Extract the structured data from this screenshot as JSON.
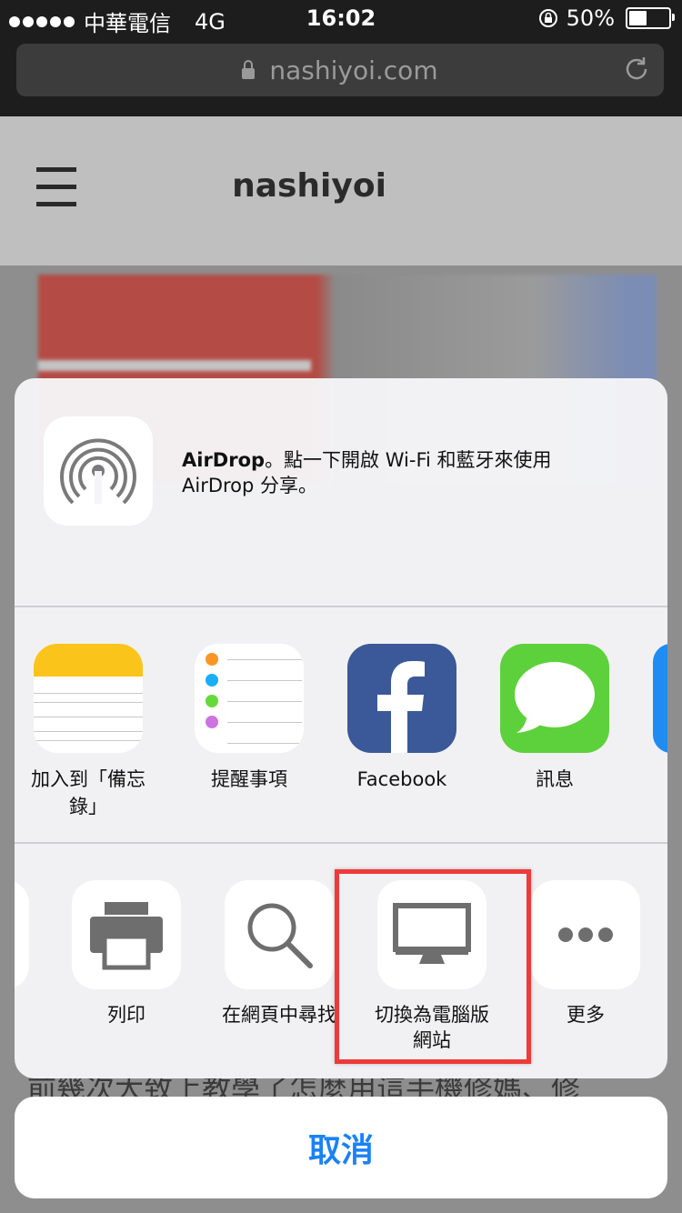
{
  "status_bar": {
    "carrier": "中華電信",
    "network": "4G",
    "time": "16:02",
    "battery": "50%",
    "battery_level": 0.5
  },
  "browser": {
    "url": "nashiyoi.com",
    "lock_icon": "lock-icon",
    "reload_icon": "reload-icon"
  },
  "site": {
    "title": "nashiyoi",
    "menu_icon": "hamburger-icon",
    "article_text": "前幾次大致上教學了怎麼用這手機修媽、修"
  },
  "share_sheet": {
    "airdrop": {
      "title": "AirDrop",
      "description_line1": "。點一下開啟 Wi-Fi 和藍牙來使用",
      "description_line2": "AirDrop 分享。",
      "icon": "airdrop-icon"
    },
    "apps": [
      {
        "label_line1": "加入到「備忘",
        "label_line2": "錄」",
        "icon": "notes-icon"
      },
      {
        "label_line1": "提醒事項",
        "label_line2": "",
        "icon": "reminders-icon"
      },
      {
        "label_line1": "Facebook",
        "label_line2": "",
        "icon": "facebook-icon"
      },
      {
        "label_line1": "訊息",
        "label_line2": "",
        "icon": "messages-icon"
      }
    ],
    "actions": [
      {
        "label_line1": "列印",
        "label_line2": "",
        "icon": "printer-icon"
      },
      {
        "label_line1": "在網頁中尋找",
        "label_line2": "",
        "icon": "search-icon"
      },
      {
        "label_line1": "切換為電腦版",
        "label_line2": "網站",
        "icon": "desktop-icon"
      },
      {
        "label_line1": "更多",
        "label_line2": "",
        "icon": "more-icon"
      }
    ],
    "highlight_color": "#ee3a3a"
  },
  "cancel_label": "取消",
  "colors": {
    "accent": "#1a82f7",
    "facebook": "#3b5998",
    "messages": "#5dd13b",
    "notes_yellow": "#fbc41b"
  }
}
